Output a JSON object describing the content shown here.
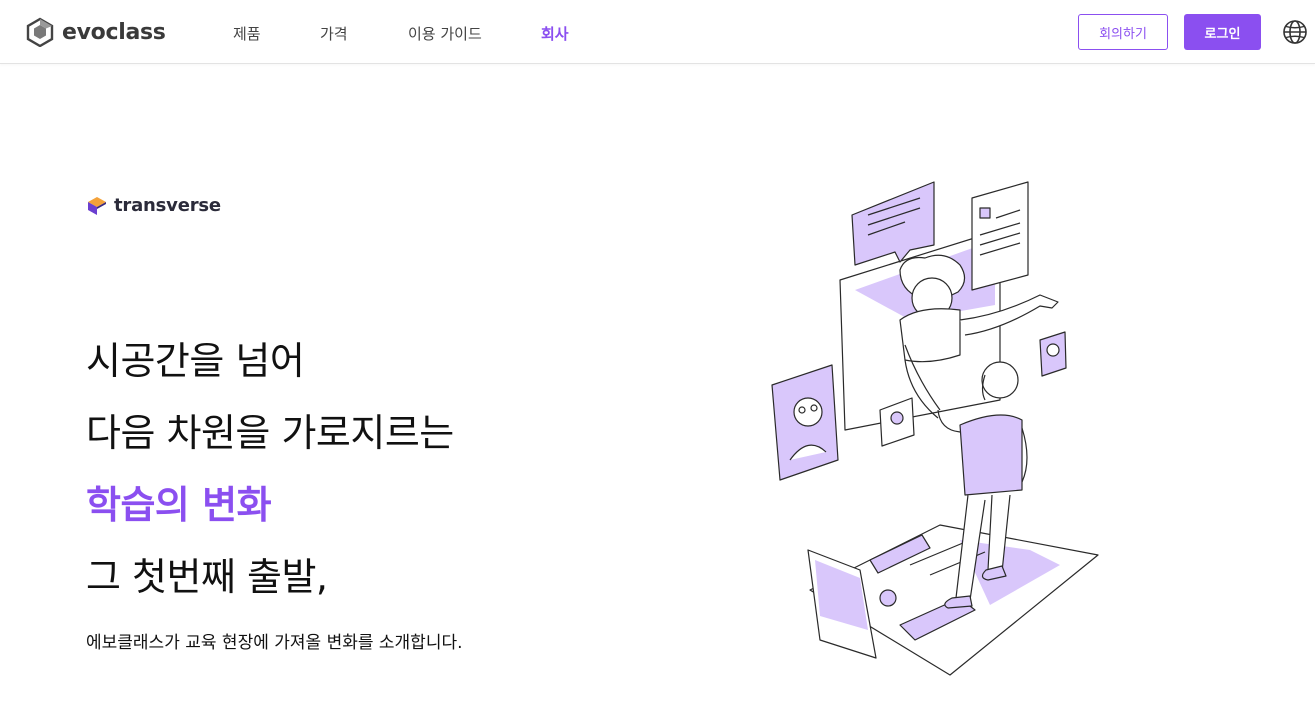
{
  "header": {
    "brand": "evoclass",
    "nav": [
      {
        "label": "제품",
        "active": false
      },
      {
        "label": "가격",
        "active": false
      },
      {
        "label": "이용 가이드",
        "active": false
      },
      {
        "label": "회사",
        "active": true
      }
    ],
    "meeting_button": "회의하기",
    "login_button": "로그인",
    "language_icon": "globe-icon"
  },
  "hero": {
    "partner_logo": "transverse",
    "headline": [
      "시공간을 넘어",
      "다음 차원을 가로지르는",
      "학습의 변화",
      "그 첫번째 출발,"
    ],
    "subtitle": "에보클래스가 교육 현장에 가져올 변화를 소개합니다."
  },
  "colors": {
    "accent": "#8b4ff0",
    "illustration_fill": "#d9c7fb",
    "text": "#111111"
  }
}
